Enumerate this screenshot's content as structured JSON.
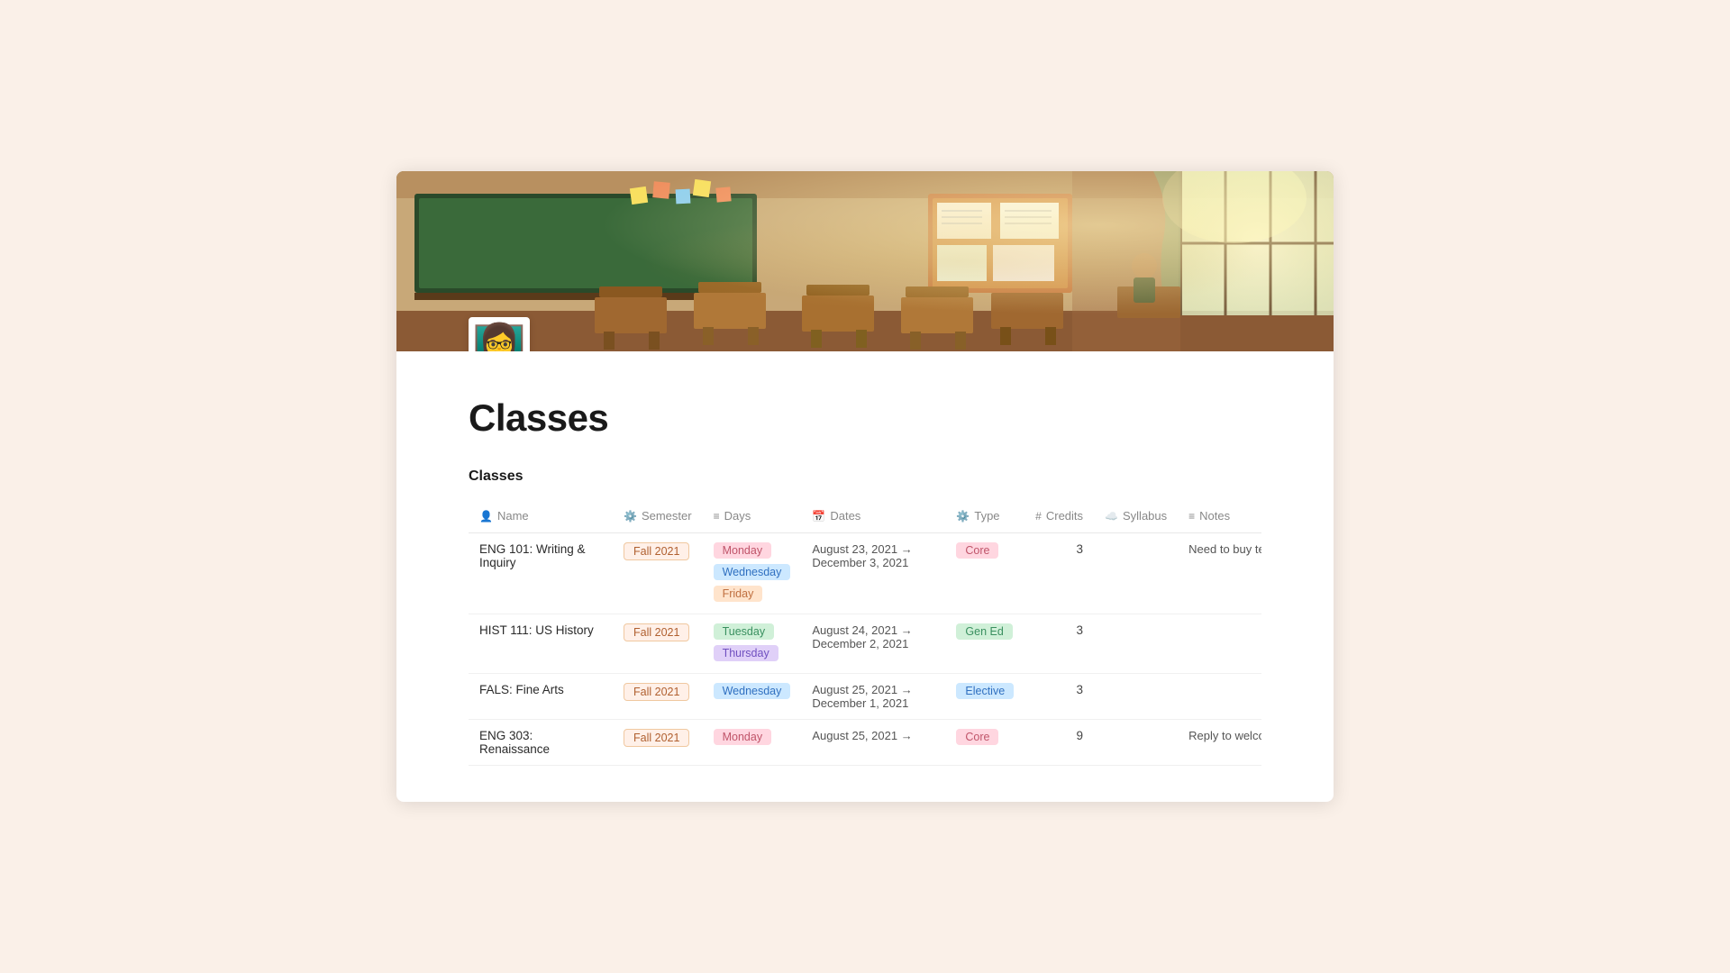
{
  "page": {
    "title": "Classes",
    "section_title": "Classes",
    "emoji": "👩‍🏫"
  },
  "table": {
    "columns": [
      {
        "icon": "👤",
        "label": "Name"
      },
      {
        "icon": "⚙️",
        "label": "Semester"
      },
      {
        "icon": "≡",
        "label": "Days"
      },
      {
        "icon": "📅",
        "label": "Dates"
      },
      {
        "icon": "⚙️",
        "label": "Type"
      },
      {
        "icon": "#",
        "label": "Credits"
      },
      {
        "icon": "☁️",
        "label": "Syllabus"
      },
      {
        "icon": "≡",
        "label": "Notes"
      }
    ],
    "rows": [
      {
        "name": "ENG 101: Writing & Inquiry",
        "semester": "Fall 2021",
        "semester_tag": "fall",
        "days": [
          "Monday",
          "Wednesday",
          "Friday"
        ],
        "days_tags": [
          "pink",
          "blue",
          "orange"
        ],
        "dates": "August 23, 2021 → December 3, 2021",
        "type": "Core",
        "type_tag": "pink",
        "credits": "3",
        "syllabus": "",
        "notes": "Need to buy textbook"
      },
      {
        "name": "HIST 111: US History",
        "semester": "Fall 2021",
        "semester_tag": "fall",
        "days": [
          "Tuesday",
          "Thursday"
        ],
        "days_tags": [
          "green",
          "purple"
        ],
        "dates": "August 24, 2021 → December 2, 2021",
        "type": "Gen Ed",
        "type_tag": "green",
        "credits": "3",
        "syllabus": "",
        "notes": ""
      },
      {
        "name": "FALS: Fine Arts",
        "semester": "Fall 2021",
        "semester_tag": "fall",
        "days": [
          "Wednesday"
        ],
        "days_tags": [
          "blue"
        ],
        "dates": "August 25, 2021 → December 1, 2021",
        "type": "Elective",
        "type_tag": "blue",
        "credits": "3",
        "syllabus": "",
        "notes": ""
      },
      {
        "name": "ENG 303: Renaissance",
        "semester": "Fall 2021",
        "semester_tag": "fall",
        "days": [
          "Monday"
        ],
        "days_tags": [
          "pink"
        ],
        "dates": "August 25, 2021 →",
        "type": "Core",
        "type_tag": "pink",
        "credits": "9",
        "syllabus": "",
        "notes": "Reply to welcome email"
      }
    ]
  }
}
